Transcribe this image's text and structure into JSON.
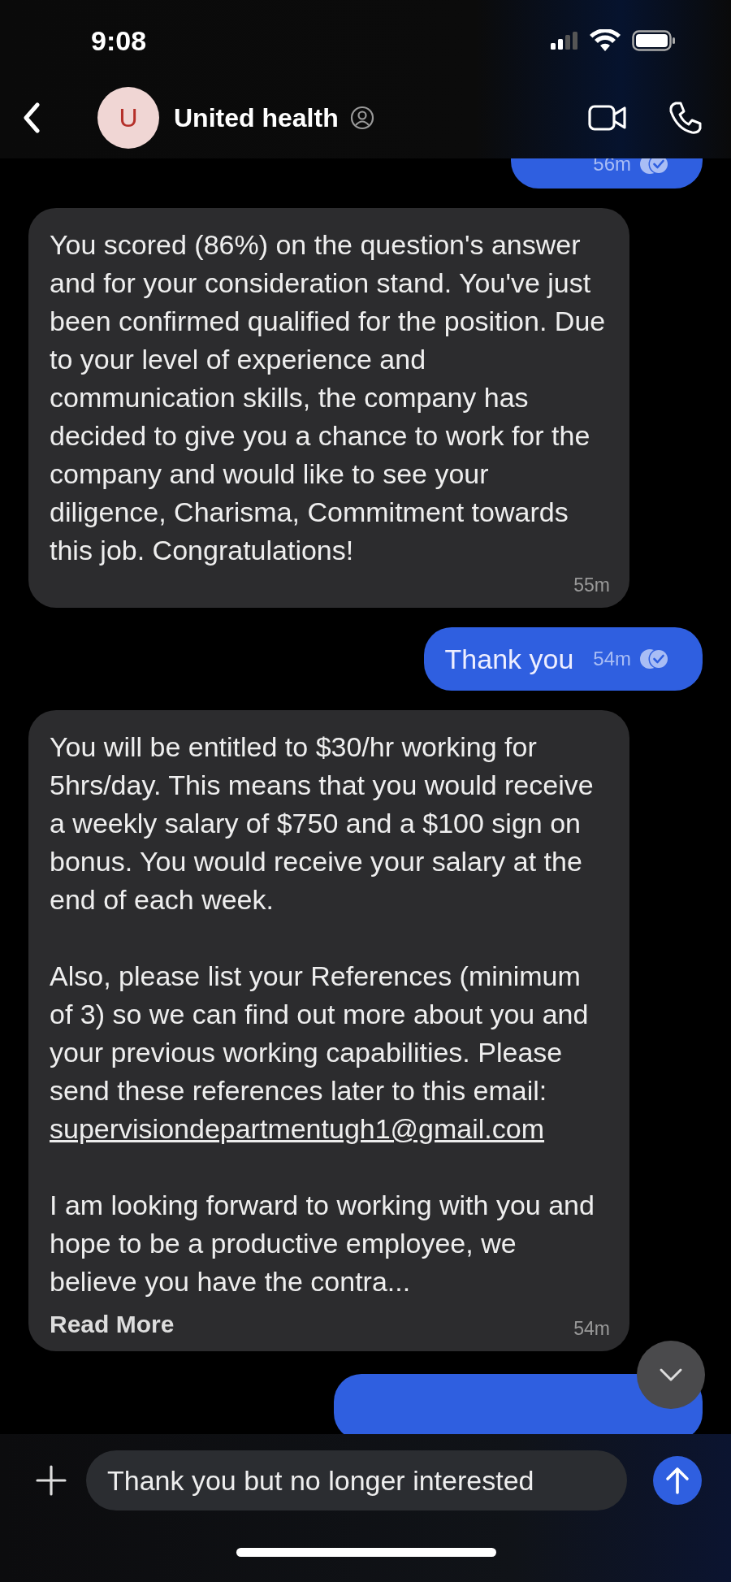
{
  "status_bar": {
    "time": "9:08"
  },
  "header": {
    "avatar_letter": "U",
    "name": "United health"
  },
  "messages": [
    {
      "kind": "outgoing",
      "clipped": true,
      "time": "56m"
    },
    {
      "kind": "incoming",
      "time": "55m",
      "paragraphs": [
        {
          "text": "You scored (86%) on the question's answer and for your consideration stand. You've just been confirmed qualified for the position. Due to your level of experience and communication skills, the company has decided to give you a chance to work for the company and would like to see your diligence, Charisma, Commitment towards this job. Congratulations!"
        }
      ]
    },
    {
      "kind": "outgoing",
      "time": "54m",
      "paragraphs": [
        {
          "text": "Thank you"
        }
      ]
    },
    {
      "kind": "incoming",
      "time": "54m",
      "read_more": "Read More",
      "paragraphs": [
        {
          "text": "You will be entitled to $30/hr working for 5hrs/day. This means that you would receive a weekly salary of $750 and a $100 sign on bonus. You would receive your salary at the end of each week."
        },
        {
          "text": "Also, please list your References (minimum of 3) so we can find out more about you and your previous working capabilities. Please send these references later to this email:",
          "link": "supervisiondepartmentugh1@gmail.com"
        },
        {
          "text": "I am looking forward to working with you and hope to be a productive employee, we believe you have the contra..."
        }
      ]
    },
    {
      "kind": "outgoing",
      "clipped": true
    }
  ],
  "composer": {
    "value": "Thank you but no longer interested"
  }
}
